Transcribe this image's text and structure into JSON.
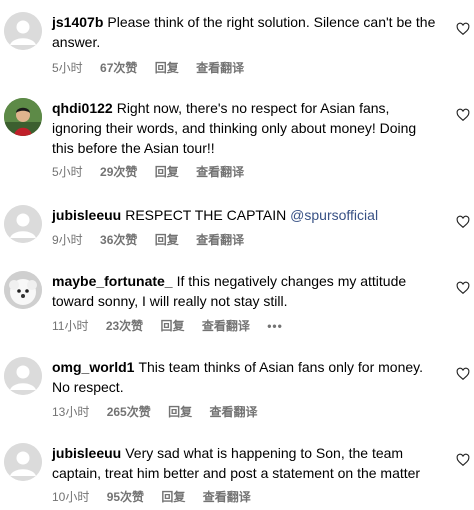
{
  "comments": [
    {
      "username": "js1407b",
      "text": "Please think of the right solution. Silence can't be the answer.",
      "time": "5小时",
      "likes": "67次赞",
      "reply": "回复",
      "translate": "查看翻译",
      "avatar": "default-avatar"
    },
    {
      "username": "qhdi0122",
      "text": "Right now, there's no respect for Asian fans, ignoring their words, and thinking only about money! Doing this before the Asian tour!!",
      "time": "5小时",
      "likes": "29次赞",
      "reply": "回复",
      "translate": "查看翻译",
      "avatar": "photo-avatar"
    },
    {
      "username": "jubisleeuu",
      "text": "RESPECT THE CAPTAIN",
      "mention": "@spursofficial",
      "time": "9小时",
      "likes": "36次赞",
      "reply": "回复",
      "translate": "查看翻译",
      "avatar": "default-avatar"
    },
    {
      "username": "maybe_fortunate_",
      "text": "If this negatively changes my attitude toward sonny, I will really not stay still.",
      "time": "11小时",
      "likes": "23次赞",
      "reply": "回复",
      "translate": "查看翻译",
      "more": "•••",
      "avatar": "dog-avatar"
    },
    {
      "username": "omg_world1",
      "text": "This team thinks of Asian fans only for money. No respect.",
      "time": "13小时",
      "likes": "265次赞",
      "reply": "回复",
      "translate": "查看翻译",
      "avatar": "default-avatar"
    },
    {
      "username": "jubisleeuu",
      "text": "Very sad what is happening to Son, the team captain, treat him better and post a statement on the matter",
      "time": "10小时",
      "likes": "95次赞",
      "reply": "回复",
      "translate": "查看翻译",
      "avatar": "default-avatar"
    }
  ],
  "icons": {
    "like": "heart-outline-icon",
    "more": "more-horizontal-icon"
  },
  "colors": {
    "meta": "#737373",
    "mention": "#385185",
    "avatar_bg": "#dbdbdb"
  }
}
